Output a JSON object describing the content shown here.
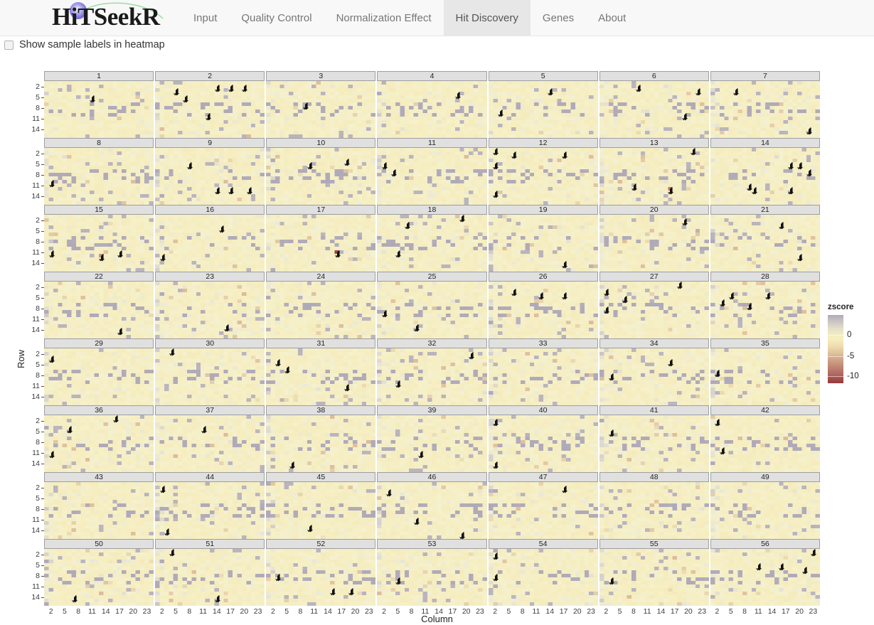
{
  "app": {
    "brand": "HiTSeekR",
    "logo_icon": "hitseekr-logo-icon"
  },
  "nav": {
    "items": [
      {
        "label": "Input",
        "active": false
      },
      {
        "label": "Quality Control",
        "active": false
      },
      {
        "label": "Normalization Effect",
        "active": false
      },
      {
        "label": "Hit Discovery",
        "active": true
      },
      {
        "label": "Genes",
        "active": false
      },
      {
        "label": "About",
        "active": false
      }
    ],
    "active_tab": "Hit Discovery"
  },
  "controls": {
    "show_sample_labels": {
      "label": "Show sample labels in heatmap",
      "checked": false
    }
  },
  "chart_data": {
    "type": "heatmap",
    "title": "",
    "xlabel": "Column",
    "ylabel": "Row",
    "facet_label": "plate",
    "panels": [
      1,
      2,
      3,
      4,
      5,
      6,
      7,
      8,
      9,
      10,
      11,
      12,
      13,
      14,
      15,
      16,
      17,
      18,
      19,
      20,
      21,
      22,
      23,
      24,
      25,
      26,
      27,
      28,
      29,
      30,
      31,
      32,
      33,
      34,
      35,
      36,
      37,
      38,
      39,
      40,
      41,
      42,
      43,
      44,
      45,
      46,
      47,
      48,
      49,
      50,
      51,
      52,
      53,
      54,
      55,
      56
    ],
    "panel_rows": 8,
    "panel_cols": 7,
    "grid_rows": 16,
    "grid_cols": 24,
    "x_ticks": [
      2,
      5,
      8,
      11,
      14,
      17,
      20,
      23
    ],
    "y_ticks": [
      2,
      5,
      8,
      11,
      14
    ],
    "grid": false,
    "legend": {
      "title": "zscore",
      "position": "right",
      "ticks": [
        0,
        -5,
        -10
      ],
      "tick_labels": [
        "0",
        "-5",
        "-10"
      ],
      "range": [
        -12,
        2
      ],
      "colors_low_to_high": [
        "#953a3c",
        "#b06a62",
        "#cfa287",
        "#eedcae",
        "#f6ecbc",
        "#e3dfc8",
        "#b0aab8"
      ]
    },
    "hit_marker": {
      "name": "hit-marker-icon",
      "color": "#111111",
      "description": "small black arrow glyph marking a screening hit well"
    },
    "hits": [
      {
        "panel": 1,
        "col": 11,
        "row": 5
      },
      {
        "panel": 2,
        "col": 5,
        "row": 3
      },
      {
        "panel": 2,
        "col": 14,
        "row": 2
      },
      {
        "panel": 2,
        "col": 17,
        "row": 2
      },
      {
        "panel": 2,
        "col": 20,
        "row": 2
      },
      {
        "panel": 2,
        "col": 7,
        "row": 5
      },
      {
        "panel": 2,
        "col": 12,
        "row": 10
      },
      {
        "panel": 3,
        "col": 9,
        "row": 7
      },
      {
        "panel": 4,
        "col": 18,
        "row": 4
      },
      {
        "panel": 5,
        "col": 3,
        "row": 9
      },
      {
        "panel": 5,
        "col": 14,
        "row": 3
      },
      {
        "panel": 6,
        "col": 9,
        "row": 2
      },
      {
        "panel": 6,
        "col": 22,
        "row": 3
      },
      {
        "panel": 6,
        "col": 19,
        "row": 10
      },
      {
        "panel": 7,
        "col": 6,
        "row": 3
      },
      {
        "panel": 7,
        "col": 22,
        "row": 14
      },
      {
        "panel": 8,
        "col": 2,
        "row": 10
      },
      {
        "panel": 9,
        "col": 8,
        "row": 5
      },
      {
        "panel": 9,
        "col": 14,
        "row": 12
      },
      {
        "panel": 9,
        "col": 17,
        "row": 12
      },
      {
        "panel": 9,
        "col": 21,
        "row": 12
      },
      {
        "panel": 10,
        "col": 10,
        "row": 5
      },
      {
        "panel": 10,
        "col": 18,
        "row": 4
      },
      {
        "panel": 11,
        "col": 2,
        "row": 5
      },
      {
        "panel": 11,
        "col": 4,
        "row": 7
      },
      {
        "panel": 12,
        "col": 2,
        "row": 1
      },
      {
        "panel": 12,
        "col": 6,
        "row": 2
      },
      {
        "panel": 12,
        "col": 2,
        "row": 5
      },
      {
        "panel": 12,
        "col": 17,
        "row": 2
      },
      {
        "panel": 12,
        "col": 2,
        "row": 13
      },
      {
        "panel": 13,
        "col": 21,
        "row": 1
      },
      {
        "panel": 13,
        "col": 8,
        "row": 11
      },
      {
        "panel": 13,
        "col": 16,
        "row": 12
      },
      {
        "panel": 14,
        "col": 18,
        "row": 5
      },
      {
        "panel": 14,
        "col": 20,
        "row": 5
      },
      {
        "panel": 14,
        "col": 22,
        "row": 7
      },
      {
        "panel": 14,
        "col": 9,
        "row": 11
      },
      {
        "panel": 14,
        "col": 10,
        "row": 12
      },
      {
        "panel": 14,
        "col": 18,
        "row": 12
      },
      {
        "panel": 15,
        "col": 2,
        "row": 11
      },
      {
        "panel": 15,
        "col": 13,
        "row": 12
      },
      {
        "panel": 15,
        "col": 17,
        "row": 11
      },
      {
        "panel": 16,
        "col": 15,
        "row": 4
      },
      {
        "panel": 16,
        "col": 2,
        "row": 12
      },
      {
        "panel": 17,
        "col": 16,
        "row": 11
      },
      {
        "panel": 18,
        "col": 7,
        "row": 3
      },
      {
        "panel": 18,
        "col": 19,
        "row": 1
      },
      {
        "panel": 18,
        "col": 5,
        "row": 11
      },
      {
        "panel": 19,
        "col": 17,
        "row": 14
      },
      {
        "panel": 20,
        "col": 19,
        "row": 2
      },
      {
        "panel": 21,
        "col": 16,
        "row": 3
      },
      {
        "panel": 21,
        "col": 20,
        "row": 12
      },
      {
        "panel": 22,
        "col": 17,
        "row": 14
      },
      {
        "panel": 23,
        "col": 16,
        "row": 13
      },
      {
        "panel": 25,
        "col": 2,
        "row": 9
      },
      {
        "panel": 25,
        "col": 9,
        "row": 13
      },
      {
        "panel": 26,
        "col": 6,
        "row": 3
      },
      {
        "panel": 26,
        "col": 12,
        "row": 4
      },
      {
        "panel": 26,
        "col": 17,
        "row": 4
      },
      {
        "panel": 27,
        "col": 2,
        "row": 3
      },
      {
        "panel": 27,
        "col": 6,
        "row": 5
      },
      {
        "panel": 27,
        "col": 18,
        "row": 1
      },
      {
        "panel": 27,
        "col": 2,
        "row": 8
      },
      {
        "panel": 28,
        "col": 5,
        "row": 4
      },
      {
        "panel": 28,
        "col": 13,
        "row": 4
      },
      {
        "panel": 28,
        "col": 3,
        "row": 6
      },
      {
        "panel": 28,
        "col": 9,
        "row": 7
      },
      {
        "panel": 29,
        "col": 2,
        "row": 3
      },
      {
        "panel": 30,
        "col": 4,
        "row": 1
      },
      {
        "panel": 31,
        "col": 3,
        "row": 4
      },
      {
        "panel": 31,
        "col": 5,
        "row": 6
      },
      {
        "panel": 31,
        "col": 18,
        "row": 11
      },
      {
        "panel": 32,
        "col": 5,
        "row": 10
      },
      {
        "panel": 32,
        "col": 21,
        "row": 2
      },
      {
        "panel": 34,
        "col": 3,
        "row": 8
      },
      {
        "panel": 34,
        "col": 16,
        "row": 4
      },
      {
        "panel": 35,
        "col": 2,
        "row": 7
      },
      {
        "panel": 36,
        "col": 16,
        "row": 1
      },
      {
        "panel": 36,
        "col": 6,
        "row": 4
      },
      {
        "panel": 36,
        "col": 2,
        "row": 11
      },
      {
        "panel": 37,
        "col": 11,
        "row": 4
      },
      {
        "panel": 38,
        "col": 6,
        "row": 14
      },
      {
        "panel": 39,
        "col": 10,
        "row": 11
      },
      {
        "panel": 40,
        "col": 2,
        "row": 2
      },
      {
        "panel": 40,
        "col": 2,
        "row": 14
      },
      {
        "panel": 41,
        "col": 3,
        "row": 5
      },
      {
        "panel": 42,
        "col": 2,
        "row": 2
      },
      {
        "panel": 42,
        "col": 3,
        "row": 10
      },
      {
        "panel": 44,
        "col": 2,
        "row": 2
      },
      {
        "panel": 44,
        "col": 3,
        "row": 14
      },
      {
        "panel": 45,
        "col": 10,
        "row": 13
      },
      {
        "panel": 46,
        "col": 3,
        "row": 3
      },
      {
        "panel": 46,
        "col": 9,
        "row": 11
      },
      {
        "panel": 46,
        "col": 19,
        "row": 15
      },
      {
        "panel": 47,
        "col": 17,
        "row": 2
      },
      {
        "panel": 50,
        "col": 7,
        "row": 14
      },
      {
        "panel": 51,
        "col": 4,
        "row": 1
      },
      {
        "panel": 51,
        "col": 14,
        "row": 14
      },
      {
        "panel": 52,
        "col": 3,
        "row": 8
      },
      {
        "panel": 52,
        "col": 15,
        "row": 12
      },
      {
        "panel": 52,
        "col": 19,
        "row": 12
      },
      {
        "panel": 53,
        "col": 5,
        "row": 9
      },
      {
        "panel": 54,
        "col": 2,
        "row": 2
      },
      {
        "panel": 54,
        "col": 2,
        "row": 8
      },
      {
        "panel": 55,
        "col": 3,
        "row": 9
      },
      {
        "panel": 56,
        "col": 11,
        "row": 5
      },
      {
        "panel": 56,
        "col": 16,
        "row": 5
      },
      {
        "panel": 56,
        "col": 21,
        "row": 6
      },
      {
        "panel": 56,
        "col": 23,
        "row": 1
      }
    ]
  }
}
